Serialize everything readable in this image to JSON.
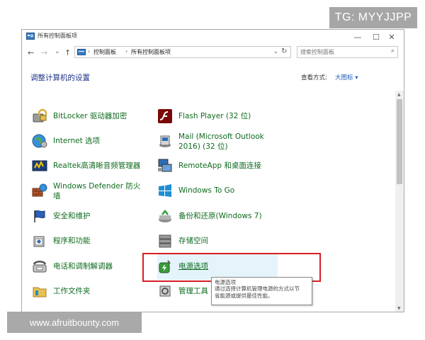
{
  "tg_label": "TG: MYYJJPP",
  "watermark": "www.afruitbounty.com",
  "window": {
    "title": "所有控制面板项",
    "controls": {
      "minimize": "—",
      "maximize": "☐",
      "close": "✕"
    },
    "nav": {
      "back": "←",
      "forward": "→",
      "dropdown": "⌄",
      "up": "↑"
    },
    "breadcrumb": [
      "控制面板",
      "所有控制面板项"
    ],
    "breadcrumb_sep": "›",
    "refresh": "↻",
    "search_placeholder": "搜索控制面板",
    "search_icon": "⌕"
  },
  "heading": "调整计算机的设置",
  "view_label": "查看方式:",
  "view_value": "大图标 ▾",
  "items": [
    {
      "label_lines": [
        "BitLocker 驱动器加密"
      ],
      "icon": "bitlocker-icon"
    },
    {
      "label_lines": [
        "Flash Player (32 位)"
      ],
      "icon": "flash-icon"
    },
    {
      "label_lines": [
        "Internet 选项"
      ],
      "icon": "internet-options-icon"
    },
    {
      "label_lines": [
        "Mail (Microsoft Outlook",
        "2016) (32 位)"
      ],
      "icon": "mail-icon"
    },
    {
      "label_lines": [
        "Realtek高清晰音频管理器"
      ],
      "icon": "realtek-audio-icon"
    },
    {
      "label_lines": [
        "RemoteApp 和桌面连接"
      ],
      "icon": "remoteapp-icon"
    },
    {
      "label_lines": [
        "Windows Defender 防火",
        "墙"
      ],
      "icon": "firewall-icon"
    },
    {
      "label_lines": [
        "Windows To Go"
      ],
      "icon": "windows-to-go-icon"
    },
    {
      "label_lines": [
        "安全和维护"
      ],
      "icon": "security-flag-icon"
    },
    {
      "label_lines": [
        "备份和还原(Windows 7)"
      ],
      "icon": "backup-icon"
    },
    {
      "label_lines": [
        "程序和功能"
      ],
      "icon": "programs-icon"
    },
    {
      "label_lines": [
        "存储空间"
      ],
      "icon": "storage-icon"
    },
    {
      "label_lines": [
        "电话和调制解调器"
      ],
      "icon": "phone-modem-icon"
    },
    {
      "label_lines": [
        "电源选项"
      ],
      "icon": "power-options-icon"
    },
    {
      "label_lines": [
        "工作文件夹"
      ],
      "icon": "work-folders-icon"
    },
    {
      "label_lines": [
        "管理工具"
      ],
      "icon": "admin-tools-icon"
    }
  ],
  "tooltip": {
    "title": "电源选项",
    "lines": [
      "通过选择计算机管理电源的方式以节",
      "省能源或提供最佳性能。"
    ]
  },
  "colors": {
    "link": "#0f6b1f",
    "heading": "#1e3287",
    "highlight": "#e5f3fb",
    "annotation_box": "#d51f26"
  }
}
